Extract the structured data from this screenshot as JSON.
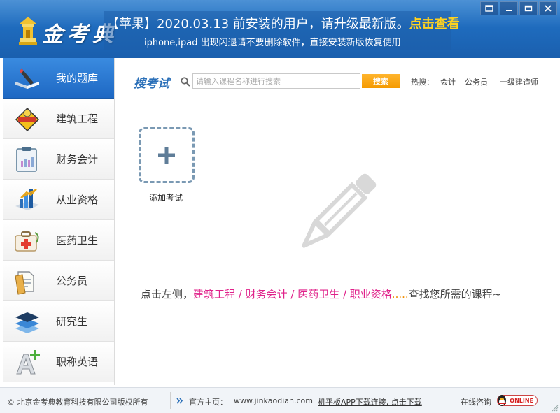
{
  "header": {
    "logo_text": "金考典",
    "notice_prefix": "【苹果】2020.03.13 前安装的用户，请升级最新版。",
    "notice_link": "点击查看",
    "notice_sub": "iphone,ipad 出现闪退请不要删除软件，直接安装新版恢复使用"
  },
  "window_controls": [
    "restore-icon",
    "minimize-icon",
    "maximize-icon",
    "close-icon"
  ],
  "sidebar": {
    "items": [
      {
        "label": "我的题库",
        "icon": "book-pen-icon",
        "active": true
      },
      {
        "label": "建筑工程",
        "icon": "construction-sign-icon"
      },
      {
        "label": "财务会计",
        "icon": "clipboard-chart-icon"
      },
      {
        "label": "从业资格",
        "icon": "bar-chart-book-icon"
      },
      {
        "label": "医药卫生",
        "icon": "first-aid-kit-icon"
      },
      {
        "label": "公务员",
        "icon": "document-folder-icon"
      },
      {
        "label": "研究生",
        "icon": "layers-icon"
      },
      {
        "label": "职称英语",
        "icon": "letter-a-plus-icon"
      }
    ]
  },
  "search": {
    "title": "搜考试",
    "placeholder": "请输入课程名称进行搜索",
    "button_label": "搜索",
    "hot_label": "热搜：",
    "hot_links": [
      "会计",
      "公务员",
      "一级建造师"
    ]
  },
  "add_exam": {
    "label": "添加考试"
  },
  "hint": {
    "prefix": "点击左侧，",
    "categories": "建筑工程 / 财务会计 / 医药卫生 / 职业资格",
    "dots": ".....",
    "suffix": "查找您所需的课程~"
  },
  "footer": {
    "copyright": "© 北京金考典教育科技有限公司版权所有",
    "homepage_label": "官方主页：",
    "homepage_url": "www.jinkaodian.com",
    "app_link": "机平板APP下载连接, 点击下载",
    "consult_label": "在线咨询",
    "online_badge": "ONLINE"
  },
  "colors": {
    "header_blue": "#1f6cbe",
    "accent_orange": "#f59a00",
    "hint_pink": "#e0218a",
    "notice_yellow": "#ffd21f",
    "search_title_blue": "#2a6fb8"
  }
}
